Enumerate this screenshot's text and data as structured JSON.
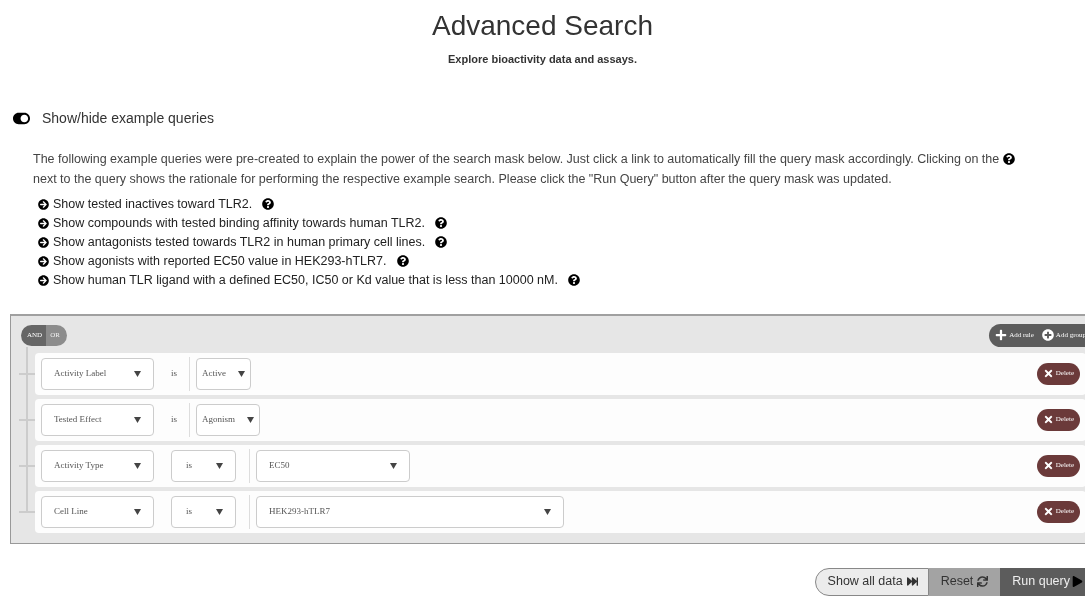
{
  "header": {
    "title": "Advanced Search",
    "subtitle": "Explore bioactivity data and assays."
  },
  "examples_toggle": {
    "label": "Show/hide example queries",
    "on": true
  },
  "description_before": "The following example queries were pre-created to explain the power of the search mask below. Just click a link to automatically fill the query mask accordingly. Clicking on the",
  "description_after": "next to the query shows the rationale for performing the respective example search. Please click the \"Run Query\" button after the query mask was updated.",
  "example_queries": [
    {
      "label": "Show tested inactives toward TLR2."
    },
    {
      "label": "Show compounds with tested binding affinity towards human TLR2."
    },
    {
      "label": "Show antagonists tested towards TLR2 in human primary cell lines."
    },
    {
      "label": "Show agonists with reported EC50 value in HEK293-hTLR7."
    },
    {
      "label": "Show human TLR ligand with a defined EC50, IC50 or Kd value that is less than 10000 nM."
    }
  ],
  "query_builder": {
    "conditions": [
      {
        "label": "AND",
        "selected": true
      },
      {
        "label": "OR",
        "selected": false
      }
    ],
    "add_rule": "Add rule",
    "add_group": "Add group",
    "rules": [
      {
        "kind": "text_operator",
        "field": "Activity Label",
        "operator": "is",
        "value": "Active",
        "delete": "Delete"
      },
      {
        "kind": "text_operator",
        "field": "Tested Effect",
        "operator": "is",
        "value": "Agonism",
        "delete": "Delete"
      },
      {
        "kind": "select_operator",
        "field": "Activity Type",
        "operator": "is",
        "value": "EC50",
        "delete": "Delete"
      },
      {
        "kind": "select_operator_wide",
        "field": "Cell Line",
        "operator": "is",
        "value": "HEK293-hTLR7",
        "delete": "Delete"
      }
    ]
  },
  "actions": {
    "show_all": "Show all data",
    "reset": "Reset",
    "run": "Run query"
  }
}
